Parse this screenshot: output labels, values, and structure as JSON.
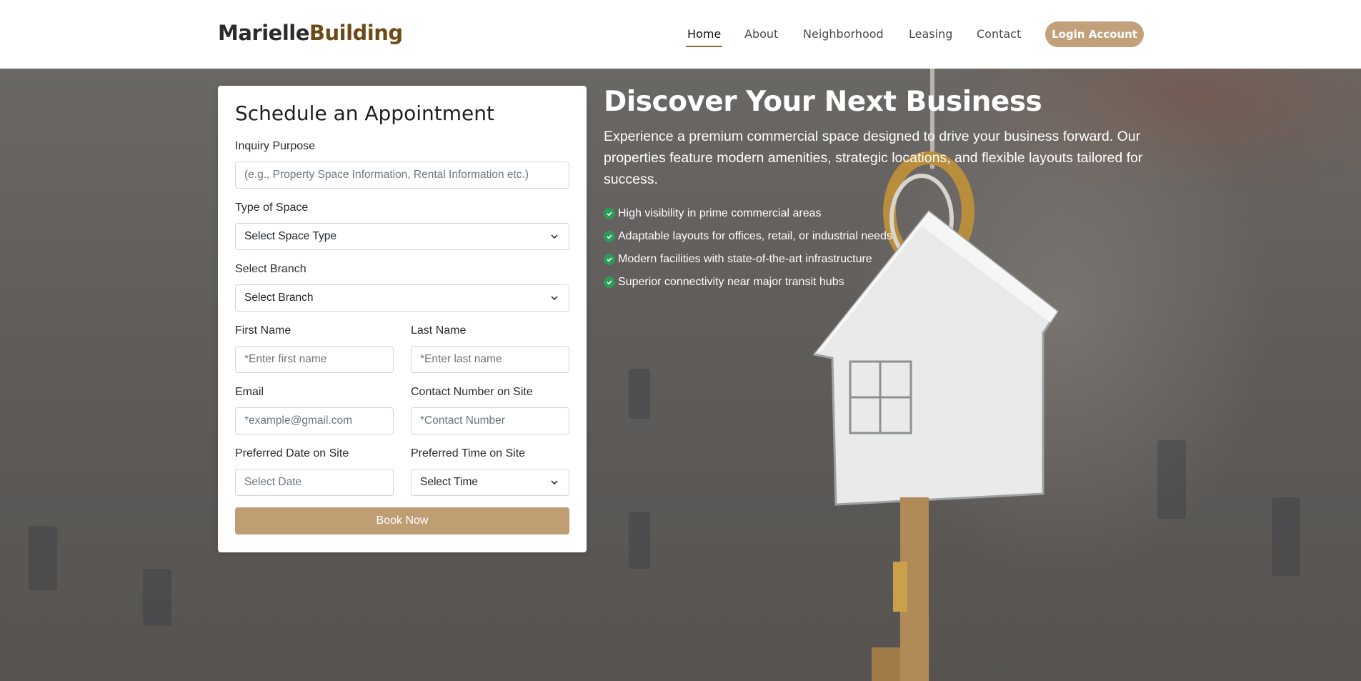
{
  "brand": {
    "part1": "Marielle",
    "part2": "Building"
  },
  "nav": {
    "items": [
      {
        "label": "Home",
        "active": true
      },
      {
        "label": "About",
        "active": false
      },
      {
        "label": "Neighborhood",
        "active": false
      },
      {
        "label": "Leasing",
        "active": false
      },
      {
        "label": "Contact",
        "active": false
      }
    ],
    "login_label": "Login Account"
  },
  "form": {
    "title": "Schedule an Appointment",
    "inquiry": {
      "label": "Inquiry Purpose",
      "placeholder": "(e.g., Property Space Information, Rental Information etc.)"
    },
    "space_type": {
      "label": "Type of Space",
      "value": "Select Space Type"
    },
    "branch": {
      "label": "Select Branch",
      "value": "Select Branch"
    },
    "first_name": {
      "label": "First Name",
      "placeholder": "*Enter first name"
    },
    "last_name": {
      "label": "Last Name",
      "placeholder": "*Enter last name"
    },
    "email": {
      "label": "Email",
      "placeholder": "*example@gmail.com"
    },
    "contact": {
      "label": "Contact Number on Site",
      "placeholder": "*Contact Number"
    },
    "date": {
      "label": "Preferred Date on Site",
      "placeholder": "Select Date"
    },
    "time": {
      "label": "Preferred Time on Site",
      "value": "Select Time"
    },
    "submit_label": "Book Now"
  },
  "hero": {
    "title": "Discover Your Next Business",
    "description": "Experience a premium commercial space designed to drive your business forward. Our properties feature modern amenities, strategic locations, and flexible layouts tailored for success.",
    "features": [
      "High visibility in prime commercial areas",
      "Adaptable layouts for offices, retail, or industrial needs",
      "Modern facilities with state-of-the-art infrastructure",
      "Superior connectivity near major transit hubs"
    ]
  },
  "colors": {
    "accent": "#c2a07a",
    "brand_dark": "#6d4a18",
    "check": "#2e9b5b"
  }
}
